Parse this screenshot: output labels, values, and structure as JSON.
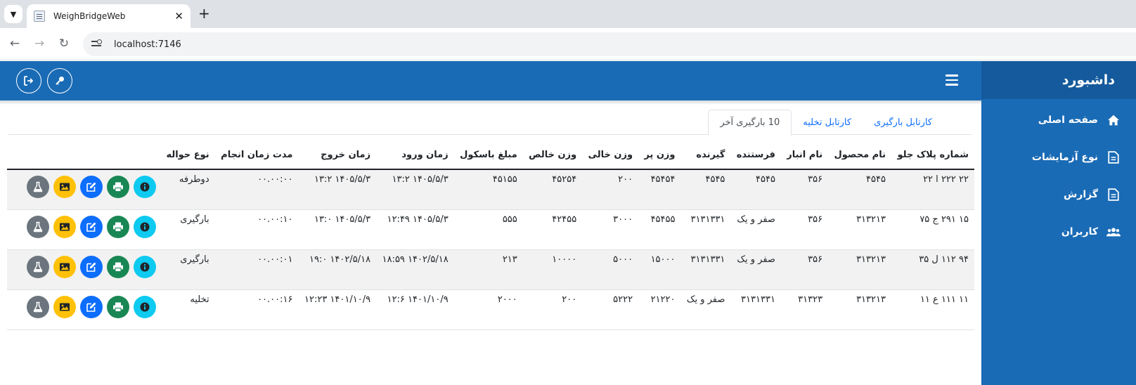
{
  "browser": {
    "tab_title": "WeighBridgeWeb",
    "url": "localhost:7146"
  },
  "sidebar": {
    "title": "داشبورد",
    "items": [
      {
        "label": "صفحه اصلی",
        "icon": "home-icon"
      },
      {
        "label": "نوع آزمایشات",
        "icon": "file-icon"
      },
      {
        "label": "گزارش",
        "icon": "file-icon"
      },
      {
        "label": "کاربران",
        "icon": "users-icon"
      }
    ]
  },
  "topbar": {
    "buttons": [
      "logout-icon",
      "key-icon",
      "menu-icon"
    ]
  },
  "tabs": [
    {
      "label": "کارتابل بارگیری",
      "active": false
    },
    {
      "label": "کارتابل تخلیه",
      "active": false
    },
    {
      "label": "10 بارگیری آخر",
      "active": true
    }
  ],
  "table": {
    "headers": [
      "شماره پلاک جلو",
      "نام محصول",
      "نام انبار",
      "فرستنده",
      "گیرنده",
      "وزن پر",
      "وزن خالی",
      "وزن خالص",
      "مبلغ باسکول",
      "زمان ورود",
      "زمان خروج",
      "مدت زمان انجام",
      "نوع حواله"
    ],
    "rows": [
      [
        "۲۲ ۲۲۲ ا ۲۲",
        "۴۵۴۵",
        "۳۵۶",
        "۴۵۴۵",
        "۴۵۴۵",
        "۴۵۴۵۴",
        "۲۰۰",
        "۴۵۲۵۴",
        "۴۵۱۵۵",
        "۱۴۰۵/۵/۳ ۱۳:۲",
        "۱۴۰۵/۵/۳ ۱۳:۲",
        "۰۰.۰۰:۰۰",
        "دوطرفه"
      ],
      [
        "۱۵ ۲۹۱ ج ۷۵",
        "۳۱۳۲۱۳",
        "۳۵۶",
        "صفر و یک",
        "۳۱۳۱۳۳۱",
        "۴۵۴۵۵",
        "۳۰۰۰",
        "۴۲۴۵۵",
        "۵۵۵",
        "۱۴۰۵/۵/۳ ۱۲:۴۹",
        "۱۴۰۵/۵/۳ ۱۳:۰",
        "۰۰.۰۰:۱۰",
        "بارگیری"
      ],
      [
        "۹۴ ۱۱۲ ل ۳۵",
        "۳۱۳۲۱۳",
        "۳۵۶",
        "صفر و یک",
        "۳۱۳۱۳۳۱",
        "۱۵۰۰۰",
        "۵۰۰۰",
        "۱۰۰۰۰",
        "۲۱۳",
        "۱۴۰۲/۵/۱۸ ۱۸:۵۹",
        "۱۴۰۲/۵/۱۸ ۱۹:۰",
        "۰۰.۰۰:۰۱",
        "بارگیری"
      ],
      [
        "۱۱ ۱۱۱ ع ۱۱",
        "۳۱۳۲۱۳",
        "۳۱۳۲۳",
        "۳۱۳۱۳۳۱",
        "صفر و یک",
        "۲۱۲۲۰",
        "۵۲۲۲",
        "۲۰۰",
        "۲۰۰۰",
        "۱۴۰۱/۱۰/۹ ۱۲:۶",
        "۱۴۰۱/۱۰/۹ ۱۲:۲۳",
        "۰۰.۰۰:۱۶",
        "تخلیه"
      ]
    ],
    "row_actions": [
      "info-icon",
      "print-icon",
      "edit-icon",
      "image-icon",
      "flask-icon"
    ]
  },
  "colors": {
    "brand": "#1a6bb5",
    "sidebar_head": "#155a9c",
    "info": "#0dcaf0",
    "success": "#198754",
    "primary": "#0d6efd",
    "warning": "#ffc107",
    "secondary": "#6c757d"
  }
}
